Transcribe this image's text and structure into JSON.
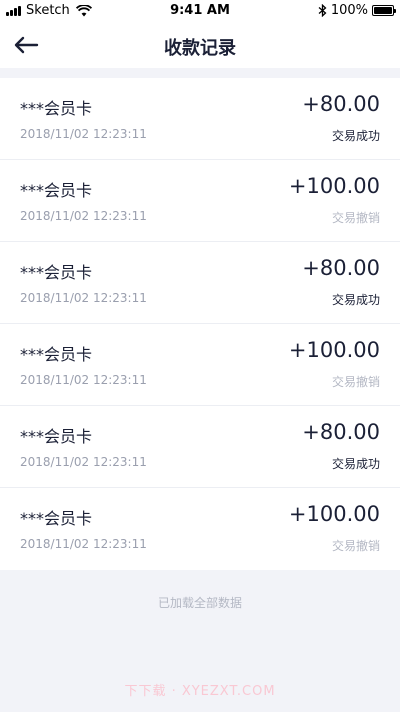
{
  "status_bar": {
    "carrier": "Sketch",
    "time": "9:41 AM",
    "battery": "100%",
    "icons": [
      "signal-icon",
      "wifi-icon",
      "bluetooth-icon",
      "battery-icon"
    ]
  },
  "nav": {
    "title": "收款记录",
    "back_icon": "arrow-left-icon"
  },
  "colors": {
    "text_primary": "#1b2036",
    "text_secondary": "#9a9fae",
    "status_success": "#1b2036",
    "status_revoked": "#b4b8c4",
    "background": "#f2f3f8"
  },
  "records": [
    {
      "name": "***会员卡",
      "time": "2018/11/02 12:23:11",
      "amount": "+80.00",
      "status": "交易成功",
      "status_type": "success"
    },
    {
      "name": "***会员卡",
      "time": "2018/11/02 12:23:11",
      "amount": "+100.00",
      "status": "交易撤销",
      "status_type": "revoked"
    },
    {
      "name": "***会员卡",
      "time": "2018/11/02 12:23:11",
      "amount": "+80.00",
      "status": "交易成功",
      "status_type": "success"
    },
    {
      "name": "***会员卡",
      "time": "2018/11/02 12:23:11",
      "amount": "+100.00",
      "status": "交易撤销",
      "status_type": "revoked"
    },
    {
      "name": "***会员卡",
      "time": "2018/11/02 12:23:11",
      "amount": "+80.00",
      "status": "交易成功",
      "status_type": "success"
    },
    {
      "name": "***会员卡",
      "time": "2018/11/02 12:23:11",
      "amount": "+100.00",
      "status": "交易撤销",
      "status_type": "revoked"
    }
  ],
  "footer": {
    "loaded_all": "已加载全部数据"
  },
  "watermark": "下下载 · XYEZXT.COM"
}
